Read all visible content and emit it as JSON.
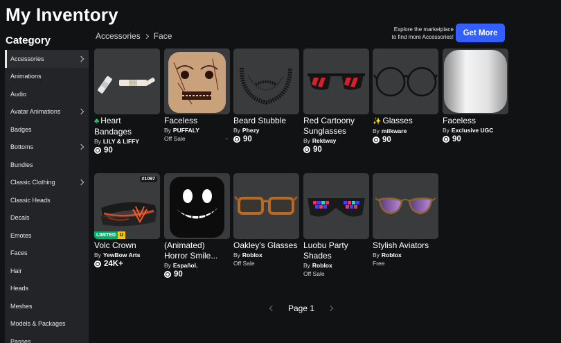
{
  "page_title": "My Inventory",
  "sidebar": {
    "title": "Category",
    "items": [
      {
        "label": "Accessories",
        "chevron": true,
        "active": true
      },
      {
        "label": "Animations",
        "chevron": false
      },
      {
        "label": "Audio",
        "chevron": false
      },
      {
        "label": "Avatar Animations",
        "chevron": true
      },
      {
        "label": "Badges",
        "chevron": false
      },
      {
        "label": "Bottoms",
        "chevron": true
      },
      {
        "label": "Bundles",
        "chevron": false
      },
      {
        "label": "Classic Clothing",
        "chevron": true
      },
      {
        "label": "Classic Heads",
        "chevron": false
      },
      {
        "label": "Decals",
        "chevron": false
      },
      {
        "label": "Emotes",
        "chevron": false
      },
      {
        "label": "Faces",
        "chevron": false
      },
      {
        "label": "Hair",
        "chevron": false
      },
      {
        "label": "Heads",
        "chevron": false
      },
      {
        "label": "Meshes",
        "chevron": false
      },
      {
        "label": "Models & Packages",
        "chevron": false
      },
      {
        "label": "Passes",
        "chevron": false
      }
    ]
  },
  "breadcrumb": {
    "parent": "Accessories",
    "current": "Face"
  },
  "promo": {
    "line1": "Explore the marketplace",
    "line2": "to find more Accessories!",
    "button": "Get More"
  },
  "items": [
    {
      "name": "Heart Bandages",
      "prefix": "clover",
      "by": "By",
      "creator": "LILY & LIFFY",
      "price": "90",
      "icon": "bandages"
    },
    {
      "name": "Faceless",
      "by": "By",
      "creator": "PUFFALY",
      "status": "Off Sale",
      "icon": "scary-face"
    },
    {
      "name": "Beard Stubble",
      "by": "By",
      "creator": "Phezy",
      "price": "90",
      "icon": "beard"
    },
    {
      "name": "Red Cartoony Sunglasses",
      "by": "By",
      "creator": "Rektway",
      "price": "90",
      "icon": "red-sunglasses"
    },
    {
      "name": "Glasses",
      "prefix": "sparkles",
      "by": "By",
      "creator": "milkware",
      "price": "90",
      "icon": "round-glasses"
    },
    {
      "name": "Faceless",
      "by": "By",
      "creator": "Exclusive UGC",
      "price": "90",
      "icon": "blank-head"
    },
    {
      "name": "Volc Crown",
      "by": "By",
      "creator": "YewBow Arts",
      "price": "24K+",
      "serial": "#1097",
      "limited": "LIMITED",
      "limited_u": "U",
      "icon": "volc-crown"
    },
    {
      "name": "(Animated) Horror Smile...",
      "by": "By",
      "creator": "Español.",
      "price": "90",
      "icon": "horror-smile"
    },
    {
      "name": "Oakley's Glasses",
      "by": "By",
      "creator": "Roblox",
      "status": "Off Sale",
      "icon": "orange-glasses"
    },
    {
      "name": "Luobu Party Shades",
      "by": "By",
      "creator": "Roblox",
      "status": "Off Sale",
      "icon": "party-shades"
    },
    {
      "name": "Stylish Aviators",
      "by": "By",
      "creator": "Roblox",
      "status": "Free",
      "icon": "aviators"
    }
  ],
  "stray_mark": "-",
  "pager": {
    "label": "Page 1"
  }
}
